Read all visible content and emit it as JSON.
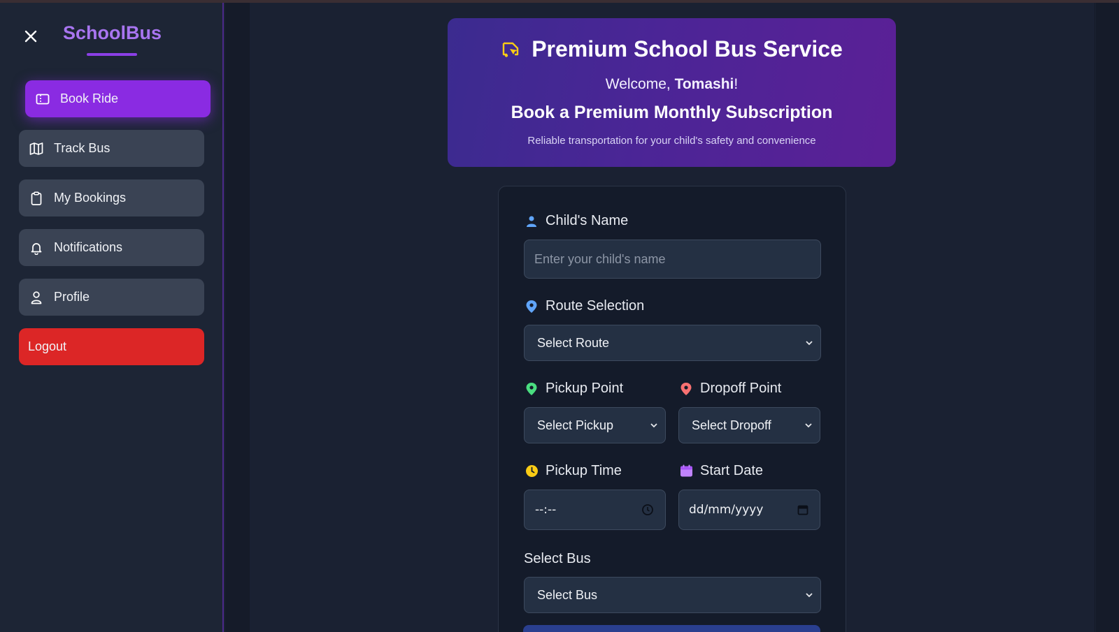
{
  "sidebar": {
    "brand": "SchoolBus",
    "items": [
      {
        "label": "Book Ride",
        "icon": "ticket-icon",
        "active": true
      },
      {
        "label": "Track Bus",
        "icon": "map-icon"
      },
      {
        "label": "My Bookings",
        "icon": "clipboard-icon"
      },
      {
        "label": "Notifications",
        "icon": "bell-icon"
      },
      {
        "label": "Profile",
        "icon": "user-icon"
      }
    ],
    "logout_label": "Logout"
  },
  "hero": {
    "title": "Premium School Bus Service",
    "welcome_prefix": "Welcome, ",
    "user_name": "Tomashi",
    "welcome_suffix": "!",
    "subtitle": "Book a Premium Monthly Subscription",
    "note": "Reliable transportation for your child's safety and convenience"
  },
  "form": {
    "child_name_label": "Child's Name",
    "child_name_placeholder": "Enter your child's name",
    "route_label": "Route Selection",
    "route_value": "Select Route",
    "pickup_label": "Pickup Point",
    "pickup_value": "Select Pickup",
    "dropoff_label": "Dropoff Point",
    "dropoff_value": "Select Dropoff",
    "pickup_time_label": "Pickup Time",
    "pickup_time_value": "--:--",
    "start_date_label": "Start Date",
    "start_date_value": "dd/mm/yyyy",
    "bus_label": "Select Bus",
    "bus_value": "Select Bus"
  },
  "colors": {
    "accent": "#8a2be2",
    "brand": "#a875f0",
    "logout": "#dc2626",
    "user_icon": "#60a5fa",
    "route_icon": "#60a5fa",
    "pickup_icon": "#4ade80",
    "dropoff_icon": "#f87171",
    "time_icon": "#facc15",
    "date_icon": "#c084fc"
  }
}
